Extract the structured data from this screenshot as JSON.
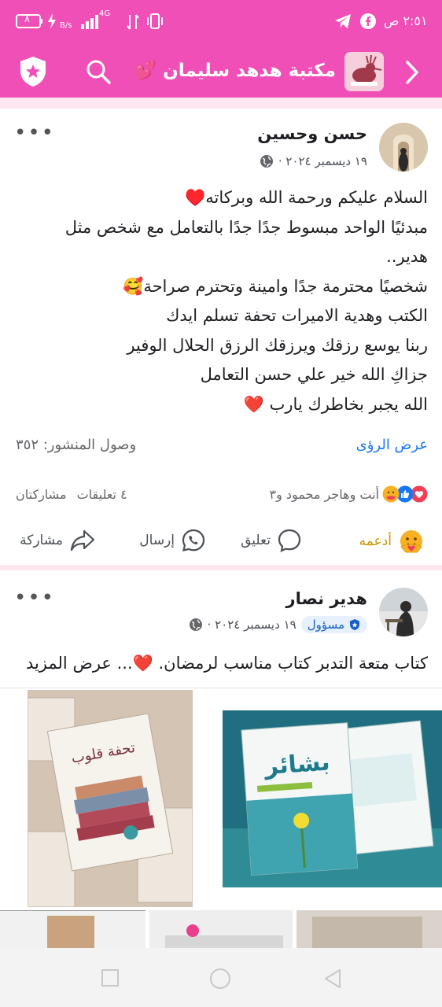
{
  "status_bar": {
    "time": "٢:٥١ ص",
    "battery": "٨",
    "network": "4G",
    "speed_unit": "B/s"
  },
  "app_bar": {
    "title": "مكتبة هدهد سليمان 💕"
  },
  "post1": {
    "author": "حسن وحسين",
    "date": "١٩ ديسمبر ٢٠٢٤ ·",
    "lines": [
      "السلام عليكم ورحمة الله وبركاته♥️",
      "مبدئيًا الواحد مبسوط جدًا جدًا بالتعامل مع شخص مثل",
      "هدير..",
      "شخصيًا محترمة جدًا وامينة وتحترم صراحة🥰",
      "الكتب وهدية الاميرات تحفة تسلم ايدك",
      "ربنا يوسع رزقك ويرزقك الرزق الحلال الوفير",
      "جزاكِ الله خير علي حسن التعامل",
      "الله يجبر بخاطرك يارب ❤️"
    ],
    "reach": "وصول المنشور: ٣٥٢",
    "view_insights": "عرض الرؤى",
    "reactors": "أنت وهاجر محمود و٣",
    "comments_count": "٤ تعليقات",
    "shares_count": "مشاركتان",
    "actions": {
      "support": "أدعمه",
      "comment": "تعليق",
      "send": "إرسال",
      "share": "مشاركة"
    }
  },
  "post2": {
    "author": "هدير نصار",
    "role_badge": "مسؤول",
    "date": "١٩ ديسمبر ٢٠٢٤ ·",
    "text": "كتاب متعة التدبر كتاب مناسب لرمضان. ❤️... عرض المزيد",
    "book_left_title": "بشائر",
    "book_right_title": "تحفة قلوب"
  },
  "colors": {
    "brand_pink": "#f04fb8",
    "link_blue": "#1877f2",
    "support_gold": "#c99700"
  }
}
